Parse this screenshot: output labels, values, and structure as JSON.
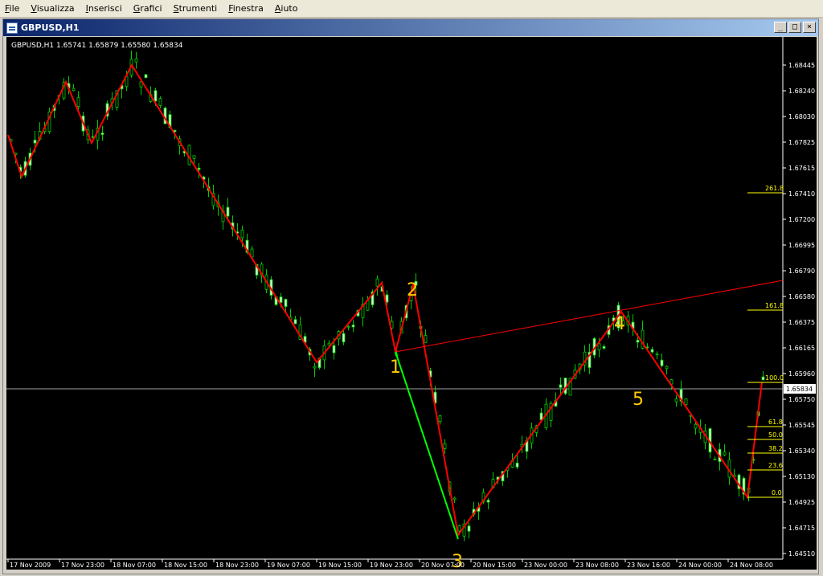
{
  "menu": [
    {
      "id": "file",
      "label": "File"
    },
    {
      "id": "visualizza",
      "label": "Visualizza"
    },
    {
      "id": "inserisci",
      "label": "Inserisci"
    },
    {
      "id": "grafici",
      "label": "Grafici"
    },
    {
      "id": "strumenti",
      "label": "Strumenti"
    },
    {
      "id": "finestra",
      "label": "Finestra"
    },
    {
      "id": "aiuto",
      "label": "Aiuto"
    }
  ],
  "window": {
    "title": "GBPUSD,H1",
    "buttons": {
      "minimize": "_",
      "maximize": "□",
      "close": "×"
    }
  },
  "chart": {
    "ohlc_text": "GBPUSD,H1  1.65741 1.65879 1.65580 1.65834",
    "current_price": "1.65834",
    "price_labels": [
      "1.68445",
      "1.68240",
      "1.68030",
      "1.67825",
      "1.67615",
      "1.67410",
      "1.67200",
      "1.66995",
      "1.66790",
      "1.66580",
      "1.66375",
      "1.66165",
      "1.65960",
      "1.65750",
      "1.65545",
      "1.65340",
      "1.65130",
      "1.64925",
      "1.64715",
      "1.64510"
    ],
    "time_labels": [
      "17 Nov 2009",
      "17 Nov 23:00",
      "18 Nov 07:00",
      "18 Nov 15:00",
      "18 Nov 23:00",
      "19 Nov 07:00",
      "19 Nov 15:00",
      "19 Nov 23:00",
      "20 Nov 07:00",
      "20 Nov 15:00",
      "23 Nov 00:00",
      "23 Nov 08:00",
      "23 Nov 16:00",
      "24 Nov 00:00",
      "24 Nov 08:00"
    ],
    "fib_levels": [
      "261.8",
      "161.8",
      "100.0",
      "61.8",
      "50.0",
      "38.2",
      "23.6",
      "0.0"
    ],
    "wave_labels": [
      "1",
      "2",
      "3",
      "4",
      "5"
    ],
    "colors": {
      "background": "#000000",
      "bull_candle": "#ccffcc",
      "bear_candle": "#000000",
      "candle_wick": "#00cc00",
      "zigzag": "#ff0000",
      "wave_line": "#00ff00",
      "fib": "#ffff00",
      "wave_label": "#ffcc00",
      "axis_text": "#ffffff"
    }
  }
}
